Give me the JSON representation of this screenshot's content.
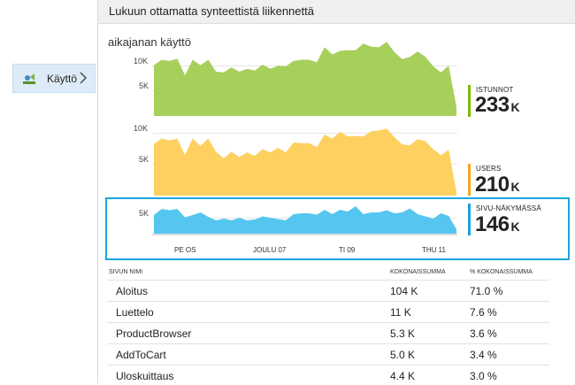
{
  "sidebar": {
    "items": [
      {
        "label": "Käyttö",
        "icon": "usage-icon"
      }
    ]
  },
  "header": {
    "title": "Lukuun ottamatta synteettistä liikennettä"
  },
  "card": {
    "title": "aikajanan käyttö",
    "x_ticks": [
      "PE OS",
      "JOULU 07",
      "TI 09",
      "THU 11"
    ],
    "metrics": [
      {
        "label": "ISTUNNOT",
        "value": "233",
        "unit": "K",
        "color": "#7fba00"
      },
      {
        "label": "USERS",
        "value": "210",
        "unit": "K",
        "color": "#f8a41b"
      },
      {
        "label": "SIVU-NÄKYMÄSSÄ",
        "value": "146",
        "unit": "K",
        "color": "#1ba1e2"
      }
    ]
  },
  "chart_data": [
    {
      "type": "area",
      "series": [
        {
          "name": "ISTUNNOT",
          "color": "#a7cf5c",
          "values": [
            8.5,
            9.4,
            9.2,
            9.6,
            6.8,
            9.4,
            8.5,
            9.4,
            7.4,
            7.3,
            8.1,
            7.4,
            7.9,
            7.6,
            8.6,
            7.9,
            8.4,
            8.3,
            9.2,
            9.4,
            9.4,
            9.0,
            11.5,
            10.3,
            10.9,
            11.0,
            11.0,
            12.1,
            11.6,
            11.5,
            12.4,
            10.7,
            9.5,
            9.9,
            10.8,
            9.9,
            8.3,
            7.3,
            8.4,
            1.5
          ]
        }
      ],
      "y_ticks": [
        "10K",
        "5K"
      ],
      "ylim": [
        0,
        12
      ]
    },
    {
      "type": "area",
      "series": [
        {
          "name": "USERS",
          "color": "#fdd060",
          "values": [
            7.8,
            8.6,
            8.3,
            8.6,
            6.1,
            8.6,
            7.5,
            8.6,
            6.6,
            5.6,
            6.6,
            5.8,
            6.5,
            6.0,
            7.0,
            6.5,
            7.2,
            6.5,
            8.0,
            7.9,
            7.9,
            7.3,
            9.2,
            8.6,
            9.6,
            8.9,
            9.0,
            8.9,
            9.7,
            9.8,
            10.1,
            8.8,
            7.7,
            7.6,
            8.5,
            8.2,
            7.0,
            6.1,
            6.9,
            0.5
          ]
        }
      ],
      "y_ticks": [
        "10K",
        "5K"
      ],
      "ylim": [
        0,
        12
      ]
    },
    {
      "type": "area",
      "series": [
        {
          "name": "SIVU-NÄKYMÄSSÄ",
          "color": "#55c6f0",
          "values": [
            4.2,
            5.6,
            5.3,
            5.6,
            3.7,
            4.2,
            4.8,
            3.8,
            3.0,
            3.4,
            3.0,
            3.6,
            3.0,
            3.2,
            3.9,
            3.6,
            3.3,
            3.0,
            4.4,
            4.6,
            4.6,
            4.3,
            5.4,
            4.4,
            5.4,
            5.0,
            6.2,
            4.4,
            4.8,
            4.8,
            5.3,
            4.6,
            4.8,
            5.7,
            4.4,
            3.9,
            3.4,
            4.6,
            4.0,
            1.0
          ]
        }
      ],
      "y_ticks": [
        "5K"
      ],
      "ylim": [
        0,
        7
      ]
    }
  ],
  "table": {
    "headers": [
      "SIVUN NIMI",
      "KOKONAISSUMMA",
      "% KOKONAISSUMMA"
    ],
    "rows": [
      [
        "Aloitus",
        "104 K",
        "71.0 %"
      ],
      [
        "Luettelo",
        "11 K",
        "7.6 %"
      ],
      [
        "ProductBrowser",
        "5.3 K",
        "3.6 %"
      ],
      [
        "AddToCart",
        "5.0 K",
        "3.4 %"
      ],
      [
        "Uloskuittaus",
        "4.4 K",
        "3.0 %"
      ]
    ]
  }
}
